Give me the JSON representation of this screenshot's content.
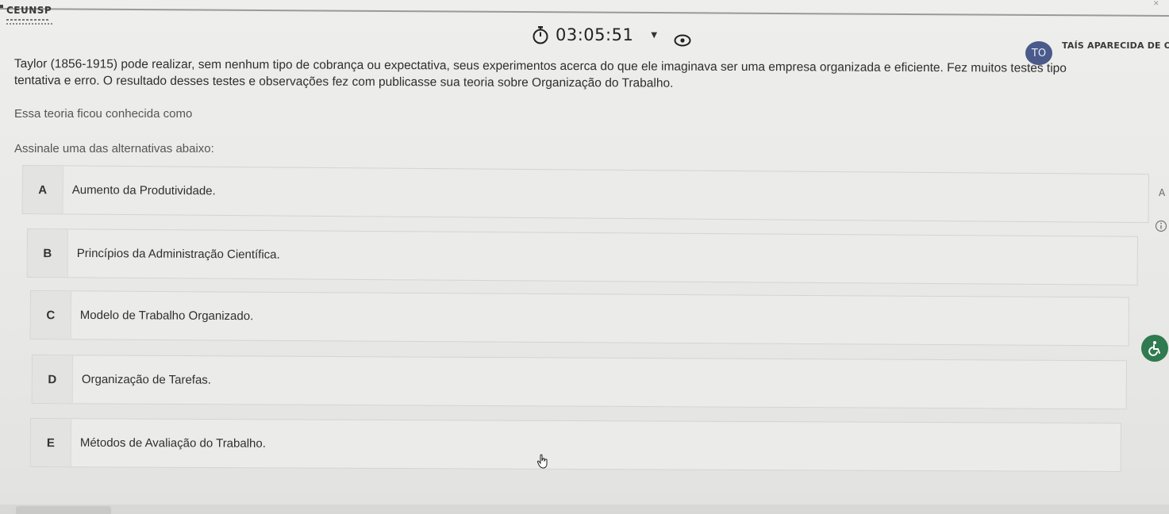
{
  "header": {
    "logo_text": "CEUNSP",
    "timer": "03:05:51",
    "user_initials": "TO",
    "user_name": "TAÍS APARECIDA DE OLIV"
  },
  "question": {
    "text_line1": "Taylor (1856-1915) pode realizar, sem nenhum tipo de cobrança ou expectativa, seus experimentos acerca do que ele imaginava ser uma empresa organizada e eficiente. Fez muitos testes tipo",
    "text_line2": "tentativa e erro. O resultado desses testes e observações fez com publicasse sua teoria sobre Organização do Trabalho.",
    "prompt": "Essa teoria ficou conhecida como",
    "instruction": "Assinale uma das alternativas abaixo:"
  },
  "options": [
    {
      "letter": "A",
      "text": "Aumento da Produtividade."
    },
    {
      "letter": "B",
      "text": "Princípios da Administração Científica."
    },
    {
      "letter": "C",
      "text": "Modelo de Trabalho Organizado."
    },
    {
      "letter": "D",
      "text": "Organização de Tarefas."
    },
    {
      "letter": "E",
      "text": "Métodos de Avaliação do Trabalho."
    }
  ],
  "side": {
    "a_label": "A"
  },
  "icons": {
    "timer": "stopwatch-icon",
    "dropdown": "caret-down-icon",
    "visibility": "eye-icon",
    "info": "info-icon",
    "accessibility": "accessibility-icon",
    "cursor": "hand-pointer-icon"
  },
  "colors": {
    "avatar_bg": "#4a5a8a",
    "accessibility_bg": "#2f7a4f"
  }
}
